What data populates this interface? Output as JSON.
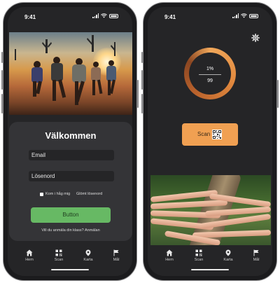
{
  "status": {
    "time": "9:41"
  },
  "login": {
    "title": "Välkommen",
    "email_placeholder": "Email",
    "password_placeholder": "Lösenord",
    "remember_label": "Kom i håg mig",
    "forgot_label": "Glömt lösenord",
    "button_label": "Button",
    "signup_text": "Vill du anmäla din klass? Anmälan"
  },
  "scan_screen": {
    "ring_top": "1%",
    "ring_bottom": "99",
    "scan_label": "Scan",
    "progress_percent": 1
  },
  "tabbar": {
    "items": [
      {
        "label": "Hem",
        "icon": "home-icon"
      },
      {
        "label": "Scan",
        "icon": "qr-icon"
      },
      {
        "label": "Karta",
        "icon": "map-pin-icon"
      },
      {
        "label": "Mål",
        "icon": "flag-icon"
      }
    ]
  },
  "colors": {
    "accent_green": "#67b964",
    "accent_orange": "#f0a052",
    "background_dark": "#252527",
    "card_dark": "#343437"
  }
}
